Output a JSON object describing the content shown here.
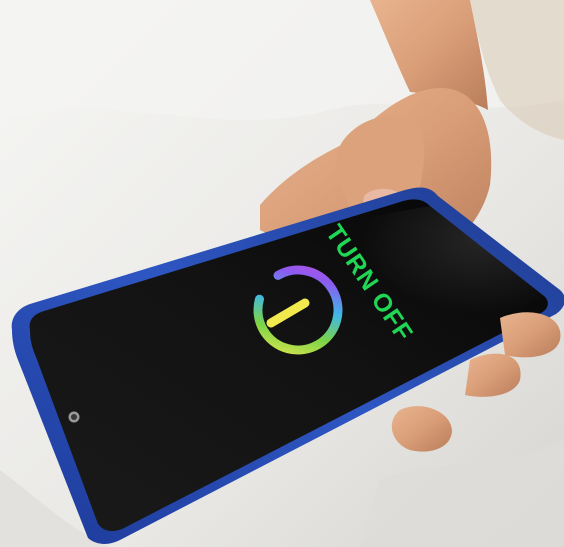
{
  "screen": {
    "power_label": "TURN OFF",
    "power_label_color": "#1fd655",
    "icon": "power-button-icon",
    "icon_gradient_colors": [
      "#f2e94e",
      "#7bd348",
      "#3fb8e8",
      "#8a5cf0",
      "#c44fe0"
    ]
  },
  "colors": {
    "phone_frame": "#2445a8",
    "phone_screen": "#141414",
    "bedsheet": "#ecebe8",
    "skin": "#d9a07a"
  }
}
